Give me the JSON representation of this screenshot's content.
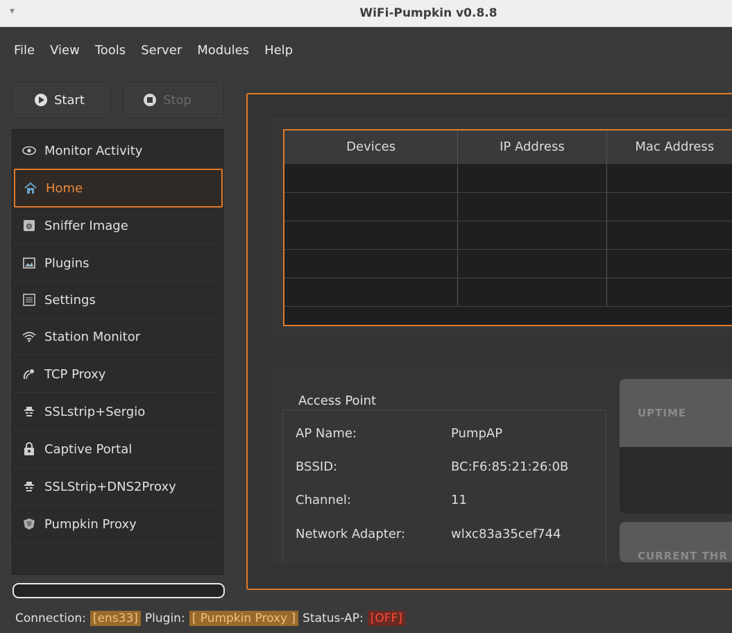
{
  "window": {
    "title": "WiFi-Pumpkin v0.8.8"
  },
  "menu": [
    {
      "label": "File"
    },
    {
      "label": "View"
    },
    {
      "label": "Tools"
    },
    {
      "label": "Server"
    },
    {
      "label": "Modules"
    },
    {
      "label": "Help"
    }
  ],
  "toolbar": {
    "start_label": "Start",
    "stop_label": "Stop"
  },
  "sidebar": {
    "items": [
      {
        "label": "Monitor Activity",
        "icon": "eye-icon"
      },
      {
        "label": "Home",
        "icon": "home-icon"
      },
      {
        "label": "Sniffer Image",
        "icon": "camera-icon"
      },
      {
        "label": "Plugins",
        "icon": "picture-icon"
      },
      {
        "label": "Settings",
        "icon": "settings-icon"
      },
      {
        "label": "Station Monitor",
        "icon": "wifi-icon"
      },
      {
        "label": "TCP Proxy",
        "icon": "satellite-icon"
      },
      {
        "label": "SSLstrip+Sergio",
        "icon": "spy-icon"
      },
      {
        "label": "Captive Portal",
        "icon": "lock-icon"
      },
      {
        "label": "SSLStrip+DNS2Proxy",
        "icon": "spy-icon"
      },
      {
        "label": "Pumpkin Proxy",
        "icon": "shield-icon"
      }
    ],
    "active": "Home"
  },
  "devices_table": {
    "columns": [
      "Devices",
      "IP Address",
      "Mac Address"
    ],
    "rows": [
      [
        "",
        "",
        ""
      ],
      [
        "",
        "",
        ""
      ],
      [
        "",
        "",
        ""
      ],
      [
        "",
        "",
        ""
      ],
      [
        "",
        "",
        ""
      ]
    ]
  },
  "access_point": {
    "title": "Access Point",
    "fields": [
      {
        "key": "AP Name:",
        "value": "PumpAP"
      },
      {
        "key": "BSSID:",
        "value": "BC:F6:85:21:26:0B"
      },
      {
        "key": "Channel:",
        "value": "11"
      },
      {
        "key": "Network Adapter:",
        "value": "wlxc83a35cef744"
      }
    ]
  },
  "cards": {
    "uptime": "UPTIME",
    "current": "CURRENT THR"
  },
  "statusbar": {
    "connection_label": "Connection:",
    "connection_value": "[ens33]",
    "plugin_label": "Plugin:",
    "plugin_value": "[ Pumpkin Proxy ]",
    "status_label": "Status-AP:",
    "status_value": "[OFF]"
  }
}
